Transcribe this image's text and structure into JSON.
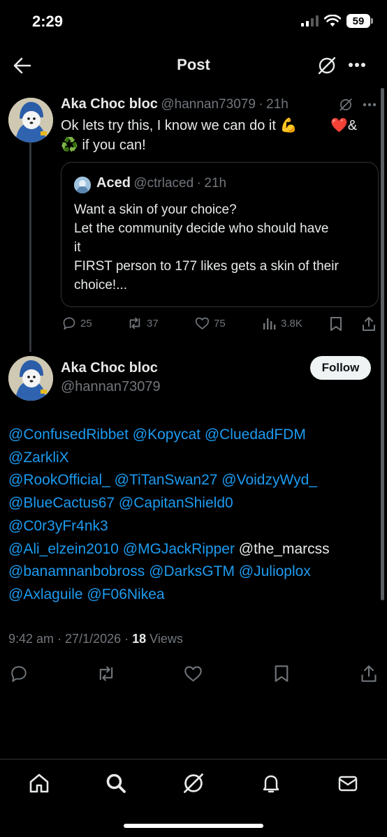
{
  "status": {
    "time": "2:29",
    "battery": "59"
  },
  "header": {
    "title": "Post"
  },
  "parent": {
    "name": "Aka Choc bloc",
    "handle": "@hannan73079",
    "sep": "·",
    "time": "21h",
    "line1": "Ok lets try this, I know we can do it 💪",
    "line1_end": "❤️&",
    "line2": "♻️ if you can!",
    "quote": {
      "name": "Aced",
      "handle": "@ctrlaced",
      "sep": "·",
      "time": "21h",
      "line1": "Want a skin of your choice?",
      "line2": "Let the community decide who should have",
      "line3": "it",
      "line4": "FIRST person to 177 likes gets a skin of their",
      "line5": "choice!..."
    },
    "stats": {
      "replies": "25",
      "reposts": "37",
      "likes": "75",
      "views": "3.8K"
    }
  },
  "reply": {
    "name": "Aka Choc bloc",
    "handle": "@hannan73079",
    "follow_label": "Follow",
    "lines": [
      [
        {
          "t": "@ConfusedRibbet",
          "m": true
        },
        {
          "t": " ",
          "m": false
        },
        {
          "t": "@Kopycat",
          "m": true
        },
        {
          "t": " ",
          "m": false
        },
        {
          "t": "@CluedadFDM",
          "m": true
        }
      ],
      [
        {
          "t": "@ZarkliX",
          "m": true
        }
      ],
      [
        {
          "t": "@RookOfficial_",
          "m": true
        },
        {
          "t": " ",
          "m": false
        },
        {
          "t": "@TiTanSwan27",
          "m": true
        },
        {
          "t": " ",
          "m": false
        },
        {
          "t": "@VoidzyWyd_",
          "m": true
        }
      ],
      [
        {
          "t": "@BlueCactus67",
          "m": true
        },
        {
          "t": " ",
          "m": false
        },
        {
          "t": "@CapitanShield0",
          "m": true
        }
      ],
      [
        {
          "t": "@C0r3yFr4nk3",
          "m": true
        }
      ],
      [
        {
          "t": "@Ali_elzein2010",
          "m": true
        },
        {
          "t": " ",
          "m": false
        },
        {
          "t": "@MGJackRipper",
          "m": true
        },
        {
          "t": " ",
          "m": false
        },
        {
          "t": "@the_marcss",
          "m": false
        }
      ],
      [
        {
          "t": "@banamnanbobross",
          "m": true
        },
        {
          "t": " ",
          "m": false
        },
        {
          "t": "@DarksGTM",
          "m": true
        },
        {
          "t": " ",
          "m": false
        },
        {
          "t": "@Julioplox",
          "m": true
        }
      ],
      [
        {
          "t": "@Axlaguile",
          "m": true
        },
        {
          "t": " ",
          "m": false
        },
        {
          "t": "@F06Nikea",
          "m": true
        }
      ]
    ],
    "meta": {
      "time": "9:42 am",
      "sep": " · ",
      "date": "27/1/2026",
      "sep2": " · ",
      "views_count": "18",
      "views_label": " Views"
    }
  },
  "icons": {
    "back": "arrow-left-icon",
    "grok": "grok-icon",
    "more": "more-icon",
    "reply": "reply-icon",
    "repost": "repost-icon",
    "like": "heart-icon",
    "views": "views-icon",
    "bookmark": "bookmark-icon",
    "share": "share-icon",
    "home": "home-icon",
    "search": "search-icon",
    "notifications": "bell-icon",
    "messages": "mail-icon"
  },
  "colors": {
    "accent": "#1d9bf0",
    "muted": "#71767b",
    "background": "#000000",
    "text": "#e7e9ea"
  }
}
